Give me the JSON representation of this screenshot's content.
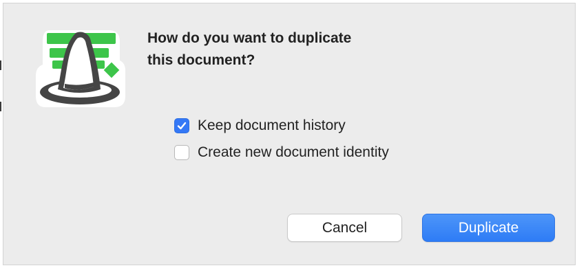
{
  "dialog": {
    "icon": "wizard-hat-app-icon",
    "title_line1": "How do you want to duplicate",
    "title_line2": "this document?",
    "options": [
      {
        "label": "Keep document history",
        "checked": true
      },
      {
        "label": "Create new document identity",
        "checked": false
      }
    ],
    "buttons": {
      "cancel_label": "Cancel",
      "duplicate_label": "Duplicate"
    }
  },
  "colors": {
    "accent": "#3478f6",
    "icon_green": "#3dc54a",
    "dialog_background": "#ececec"
  }
}
